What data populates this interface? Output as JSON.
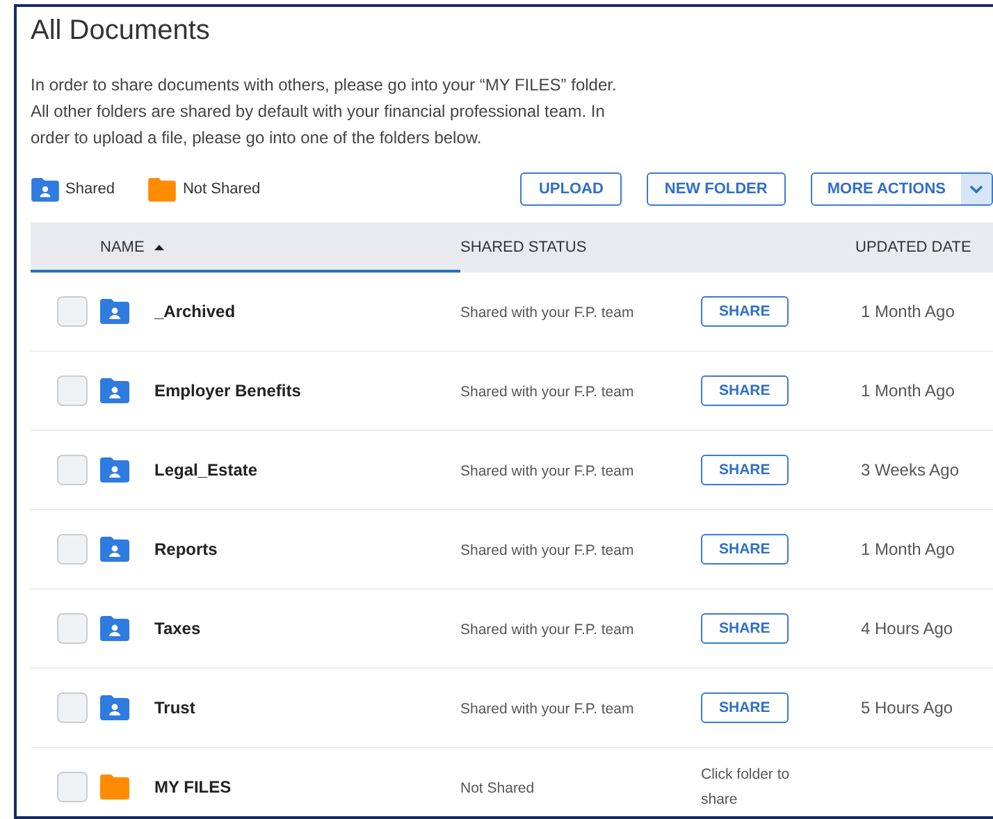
{
  "title": "All Documents",
  "intro": "In order to share documents with others, please go into your “MY FILES” folder. All other folders are shared by default with your financial professional team. In order to upload a file, please go into one of the folders below.",
  "legend": [
    {
      "kind": "shared",
      "label": "Shared"
    },
    {
      "kind": "not_shared",
      "label": "Not Shared"
    }
  ],
  "actions": [
    {
      "kind": "plain",
      "label": "UPLOAD"
    },
    {
      "kind": "plain",
      "label": "NEW FOLDER"
    },
    {
      "kind": "dropdown",
      "label": "MORE ACTIONS"
    }
  ],
  "table": {
    "columns": [
      {
        "label": "NAME",
        "sorted": true
      },
      {
        "label": "SHARED STATUS",
        "sorted": false
      },
      {
        "label": "UPDATED DATE",
        "sorted": false
      }
    ],
    "rows": [
      {
        "kind": "shared",
        "checked": false,
        "name": "_Archived",
        "status": "Shared with your F.P. team",
        "action": "SHARE",
        "updated": "1 Month Ago"
      },
      {
        "kind": "shared",
        "checked": false,
        "name": "Employer Benefits",
        "status": "Shared with your F.P. team",
        "action": "SHARE",
        "updated": "1 Month Ago"
      },
      {
        "kind": "shared",
        "checked": false,
        "name": "Legal_Estate",
        "status": "Shared with your F.P. team",
        "action": "SHARE",
        "updated": "3 Weeks Ago"
      },
      {
        "kind": "shared",
        "checked": false,
        "name": "Reports",
        "status": "Shared with your F.P. team",
        "action": "SHARE",
        "updated": "1 Month Ago"
      },
      {
        "kind": "shared",
        "checked": false,
        "name": "Taxes",
        "status": "Shared with your F.P. team",
        "action": "SHARE",
        "updated": "4 Hours Ago"
      },
      {
        "kind": "shared",
        "checked": false,
        "name": "Trust",
        "status": "Shared with your F.P. team",
        "action": "SHARE",
        "updated": "5 Hours Ago"
      },
      {
        "kind": "not_shared",
        "checked": false,
        "name": "MY FILES",
        "status": "Not Shared",
        "note": "Click folder to share"
      }
    ]
  }
}
